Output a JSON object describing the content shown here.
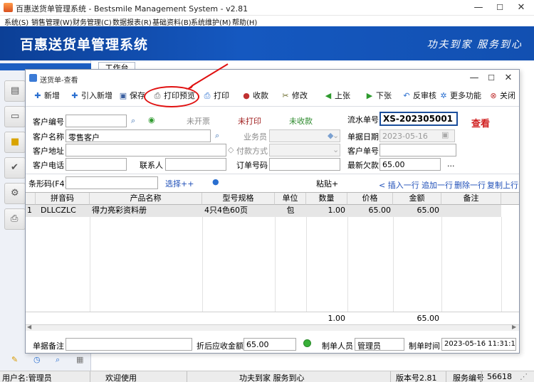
{
  "app": {
    "title": "百惠送货单管理系统 - Bestsmile Management System - v2.81",
    "win_min": "—",
    "win_max": "☐",
    "win_close": "✕"
  },
  "menu": [
    "系统(S)",
    "销售管理(W)",
    "财务管理(C)",
    "数据报表(R)",
    "基础资料(B)",
    "系统维护(M)",
    "帮助(H)"
  ],
  "banner": {
    "title": "百惠送货单管理系统",
    "slogan": "功夫到家 服务到心"
  },
  "work_tab": "工作台",
  "dialog": {
    "title": "送货单-查看",
    "toolbar": [
      {
        "label": "新增",
        "icon": "plus-icon",
        "glyph": "✚",
        "color": "#2a6fd0"
      },
      {
        "label": "引入新增",
        "icon": "import-icon",
        "glyph": "✚",
        "color": "#2a6fd0"
      },
      {
        "label": "保存",
        "icon": "save-icon",
        "glyph": "▣",
        "color": "#3a5fa0"
      },
      {
        "label": "打印预览",
        "icon": "print-preview-icon",
        "glyph": "⎙",
        "color": "#555555"
      },
      {
        "label": "打印",
        "icon": "print-icon",
        "glyph": "⎙",
        "color": "#2a6fd0"
      },
      {
        "label": "收款",
        "icon": "receive-payment-icon",
        "glyph": "●",
        "color": "#c03030"
      },
      {
        "label": "修改",
        "icon": "edit-icon",
        "glyph": "✂",
        "color": "#6a6a2a"
      },
      {
        "label": "上张",
        "icon": "previous-icon",
        "glyph": "◀",
        "color": "#2e9a2e"
      },
      {
        "label": "下张",
        "icon": "next-icon",
        "glyph": "▶",
        "color": "#2e9a2e"
      },
      {
        "label": "反审核",
        "icon": "unapprove-icon",
        "glyph": "↶",
        "color": "#2a6fd0"
      },
      {
        "label": "更多功能",
        "icon": "more-functions-icon",
        "glyph": "✲",
        "color": "#2a6fd0"
      },
      {
        "label": "关闭",
        "icon": "close-door-icon",
        "glyph": "⊗",
        "color": "#c03030"
      }
    ],
    "form": {
      "customer_code_label": "客户编号",
      "customer_code": "",
      "invoice_status": "未开票",
      "print_status": "未打印",
      "payment_status": "未收款",
      "serial_label": "流水单号",
      "serial_no": "XS-202305001",
      "view_mode": "查看",
      "customer_name_label": "客户名称",
      "customer_name": "零售客户",
      "salesperson_label": "业务员",
      "salesperson": "",
      "doc_date_label": "单据日期",
      "doc_date": "2023-05-16",
      "address_label": "客户地址",
      "address": "",
      "payment_method_label": "付款方式",
      "payment_method": "",
      "customer_order_label": "客户单号",
      "customer_order": "",
      "phone_label": "客户电话",
      "phone": "",
      "contact_label": "联系人",
      "contact": "",
      "order_no_label": "订单号码",
      "order_no": "",
      "latest_debt_label": "最新欠款",
      "latest_debt": "65.00",
      "ellipsis": "...",
      "barcode_label": "条形码(F4)",
      "barcode": "",
      "select_more": "选择++",
      "paste": "粘贴+",
      "insert_row": "< 插入一行",
      "append_row": "追加一行",
      "delete_row": "删除一行",
      "copy_row": "复制上行"
    },
    "grid": {
      "headers": [
        "拼音码",
        "产品名称",
        "型号规格",
        "单位",
        "数量",
        "价格",
        "金额",
        "备注"
      ],
      "rows": [
        {
          "no": "1",
          "pinyin": "DLLCZLC",
          "name": "得力亮彩资料册",
          "spec": "4只4色60页",
          "unit": "包",
          "qty": "1.00",
          "price": "65.00",
          "amount": "65.00",
          "note": ""
        }
      ],
      "total_qty": "1.00",
      "total_amount": "65.00"
    },
    "bottom": {
      "remark_label": "单据备注",
      "remark": "",
      "discount_label": "折后应收金额",
      "discount_amount": "65.00",
      "maker_label": "制单人员",
      "maker": "管理员",
      "make_time_label": "制单时间",
      "make_time": "2023-05-16 11:31:11"
    }
  },
  "status": {
    "user": "用户名:管理员",
    "welcome": "欢迎使用",
    "slogan": "功夫到家 服务到心",
    "version": "版本号2.81",
    "service": "服务编号",
    "service_no": "56618"
  },
  "colors": {
    "banner": "#1558c0",
    "annotation": "#e01010",
    "serial_border": "#1c4f9c"
  }
}
